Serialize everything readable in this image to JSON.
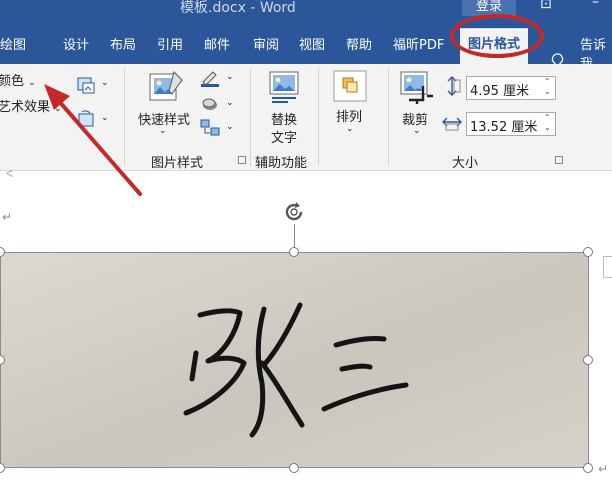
{
  "window": {
    "title": "模板.docx  -  Word",
    "login_label": "登录"
  },
  "tabs": [
    {
      "label": "绘图"
    },
    {
      "label": "设计"
    },
    {
      "label": "布局"
    },
    {
      "label": "引用"
    },
    {
      "label": "邮件"
    },
    {
      "label": "审阅"
    },
    {
      "label": "视图"
    },
    {
      "label": "帮助"
    },
    {
      "label": "福昕PDF"
    },
    {
      "label": "图片格式"
    },
    {
      "label": "告诉我"
    }
  ],
  "active_tab": "图片格式",
  "ribbon": {
    "adjust": {
      "color_label": "颜色",
      "art_effects_label": "艺术效果"
    },
    "picture_styles": {
      "quick_styles_label": "快速样式",
      "group_label": "图片样式"
    },
    "accessibility": {
      "alt_text_line1": "替换",
      "alt_text_line2": "文字",
      "group_label": "辅助功能"
    },
    "arrange": {
      "arrange_label": "排列"
    },
    "size": {
      "crop_label": "裁剪",
      "height_value": "4.95 厘米",
      "width_value": "13.52 厘米",
      "group_label": "大小"
    }
  },
  "document": {
    "picture_text": "张 三"
  },
  "colors": {
    "accent": "#2b579a",
    "annotation": "#c62828"
  }
}
